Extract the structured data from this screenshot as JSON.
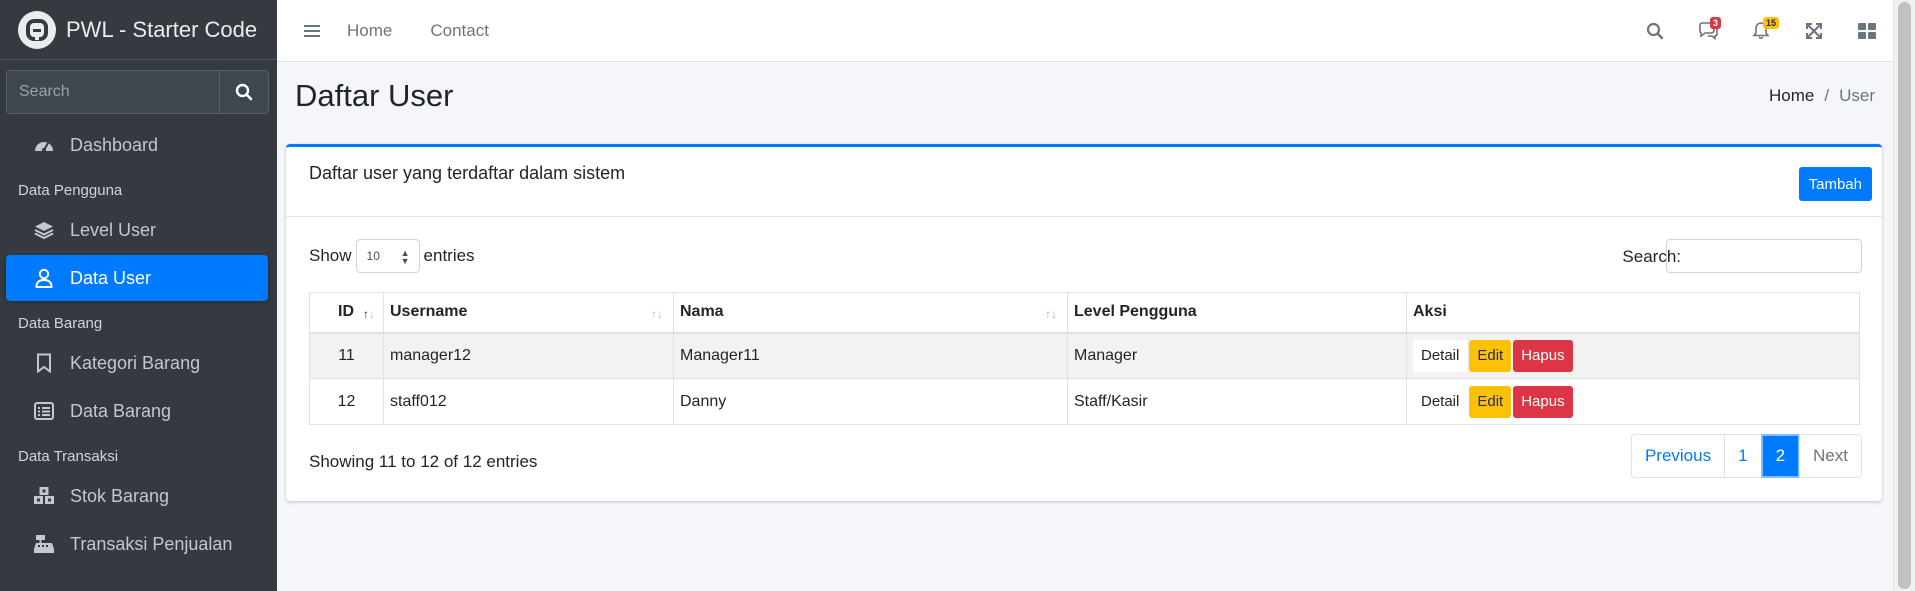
{
  "brand": {
    "title": "PWL - Starter Code"
  },
  "sidebar": {
    "search_placeholder": "Search",
    "items": [
      {
        "label": "Dashboard"
      },
      {
        "header": "Data Pengguna"
      },
      {
        "label": "Level User"
      },
      {
        "label": "Data User",
        "active": true
      },
      {
        "header": "Data Barang"
      },
      {
        "label": "Kategori Barang"
      },
      {
        "label": "Data Barang"
      },
      {
        "header": "Data Transaksi"
      },
      {
        "label": "Stok Barang"
      },
      {
        "label": "Transaksi Penjualan"
      }
    ]
  },
  "topbar": {
    "links": [
      "Home",
      "Contact"
    ],
    "messages_badge": "3",
    "notifications_badge": "15"
  },
  "page": {
    "title": "Daftar User",
    "breadcrumb": [
      "Home",
      "User"
    ]
  },
  "card": {
    "title": "Daftar user yang terdaftar dalam sistem",
    "add_button": "Tambah",
    "show_label": "Show",
    "entries_value": "10",
    "entries_label": "entries",
    "search_label": "Search:",
    "columns": [
      "ID",
      "Username",
      "Nama",
      "Level Pengguna",
      "Aksi"
    ],
    "rows": [
      {
        "id": "11",
        "username": "manager12",
        "nama": "Manager11",
        "level": "Manager"
      },
      {
        "id": "12",
        "username": "staff012",
        "nama": "Danny",
        "level": "Staff/Kasir"
      }
    ],
    "action_labels": {
      "detail": "Detail",
      "edit": "Edit",
      "hapus": "Hapus"
    },
    "info": "Showing 11 to 12 of 12 entries",
    "pagination": {
      "previous": "Previous",
      "pages": [
        "1",
        "2"
      ],
      "current": "2",
      "next": "Next"
    }
  },
  "colors": {
    "primary": "#007bff",
    "sidebar": "#343a40",
    "warning": "#ffc107",
    "danger": "#dc3545"
  }
}
